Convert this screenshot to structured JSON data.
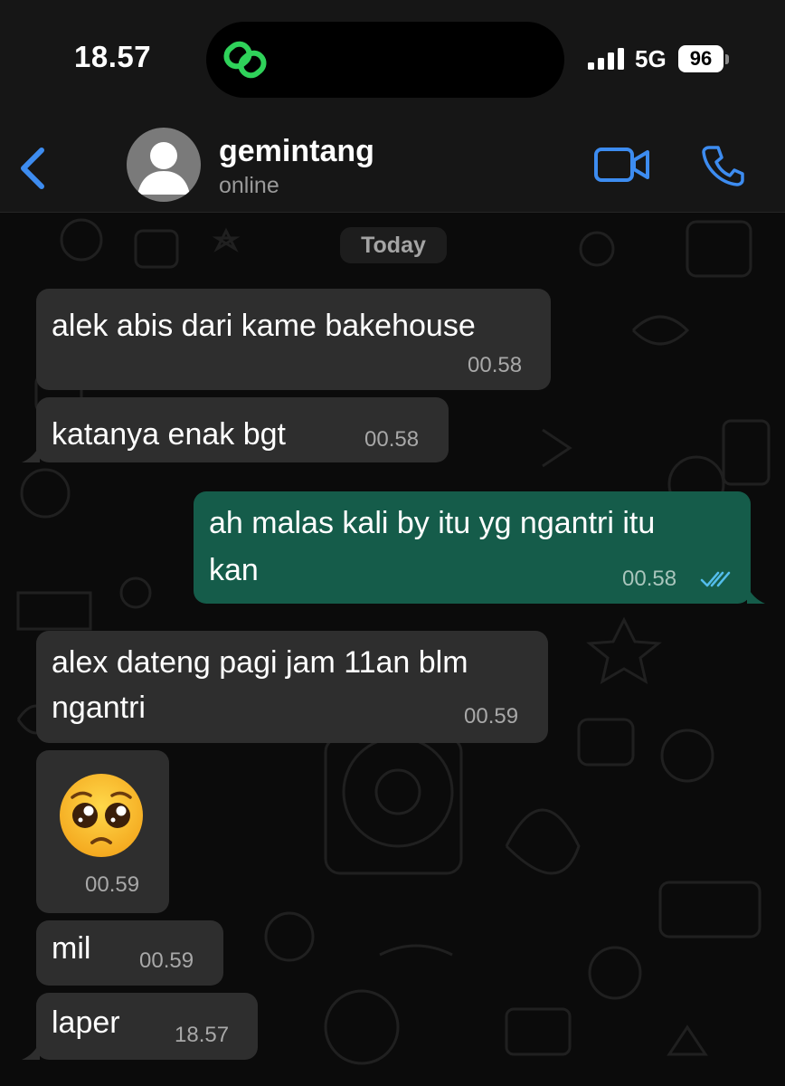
{
  "status_bar": {
    "time": "18.57",
    "network": "5G",
    "battery": "96"
  },
  "header": {
    "contact_name": "gemintang",
    "contact_status": "online"
  },
  "chat": {
    "date_label": "Today",
    "messages": [
      {
        "direction": "incoming",
        "text": "alek abis dari kame bakehouse",
        "time": "00.58"
      },
      {
        "direction": "incoming",
        "text": "katanya enak bgt",
        "time": "00.58"
      },
      {
        "direction": "outgoing",
        "text_line1": "ah malas kali by itu yg ngantri itu",
        "text_line2": "kan",
        "time": "00.58",
        "status": "read"
      },
      {
        "direction": "incoming",
        "text_line1": "alex dateng pagi jam 11an blm",
        "text_line2": "ngantri",
        "time": "00.59"
      },
      {
        "direction": "incoming",
        "emoji": "pleading-face",
        "time": "00.59"
      },
      {
        "direction": "incoming",
        "text": "mil",
        "time": "00.59"
      },
      {
        "direction": "incoming",
        "text": "laper",
        "time": "18.57"
      }
    ]
  },
  "colors": {
    "accent_blue": "#3d8cf0",
    "incoming_bubble": "#2e2e2e",
    "outgoing_bubble": "#155c4a",
    "read_ticks": "#53bdeb",
    "island_icon_green": "#2fd25a"
  }
}
